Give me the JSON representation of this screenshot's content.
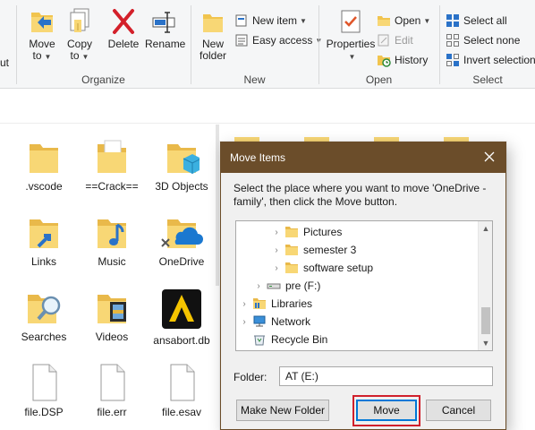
{
  "ribbon": {
    "clipboard_fragment": "ut",
    "organize": {
      "label": "Organize",
      "move_to": [
        "Move",
        "to"
      ],
      "copy_to": [
        "Copy",
        "to"
      ],
      "delete": "Delete",
      "rename": "Rename"
    },
    "new": {
      "label": "New",
      "new_folder": [
        "New",
        "folder"
      ],
      "new_item": "New item",
      "easy_access": "Easy access"
    },
    "open": {
      "label": "Open",
      "properties": "Properties",
      "open": "Open",
      "edit": "Edit",
      "history": "History"
    },
    "select": {
      "label": "Select",
      "select_all": "Select all",
      "select_none": "Select none",
      "invert_selection": "Invert selection"
    }
  },
  "files": [
    {
      "name": ".vscode",
      "icon": "folder-icon"
    },
    {
      "name": "==Crack==",
      "icon": "folder-docs-icon"
    },
    {
      "name": "3D Objects",
      "icon": "folder-3d-icon"
    },
    {
      "name": "Links",
      "icon": "folder-links-icon"
    },
    {
      "name": "Music",
      "icon": "folder-music-icon"
    },
    {
      "name": "OneDrive",
      "icon": "onedrive-folder-icon"
    },
    {
      "name": "Searches",
      "icon": "folder-search-icon"
    },
    {
      "name": "Videos",
      "icon": "folder-videos-icon"
    },
    {
      "name": "ansabort.db",
      "icon": "app-icon"
    },
    {
      "name": "file.DSP",
      "icon": "file-icon"
    },
    {
      "name": "file.err",
      "icon": "file-icon"
    },
    {
      "name": "file.esav",
      "icon": "file-icon"
    }
  ],
  "dialog": {
    "title": "Move Items",
    "instruction": "Select the place where you want to move 'OneDrive -family', then click the Move button.",
    "tree": [
      {
        "label": "Pictures",
        "icon": "folder-icon"
      },
      {
        "label": "semester 3",
        "icon": "folder-icon"
      },
      {
        "label": "software setup",
        "icon": "folder-icon"
      },
      {
        "label": "pre (F:)",
        "icon": "drive-icon"
      },
      {
        "label": "Libraries",
        "icon": "libraries-icon"
      },
      {
        "label": "Network",
        "icon": "network-icon"
      },
      {
        "label": "Recycle Bin",
        "icon": "recycle-bin-icon"
      }
    ],
    "folder_label": "Folder:",
    "folder_value": "AT (E:)",
    "buttons": {
      "make_new_folder": "Make New Folder",
      "move": "Move",
      "cancel": "Cancel"
    }
  },
  "colors": {
    "dialog_title_bar": "#6b4d2a",
    "highlight_box": "#d0202c",
    "folder_yellow": "#f8d775"
  }
}
